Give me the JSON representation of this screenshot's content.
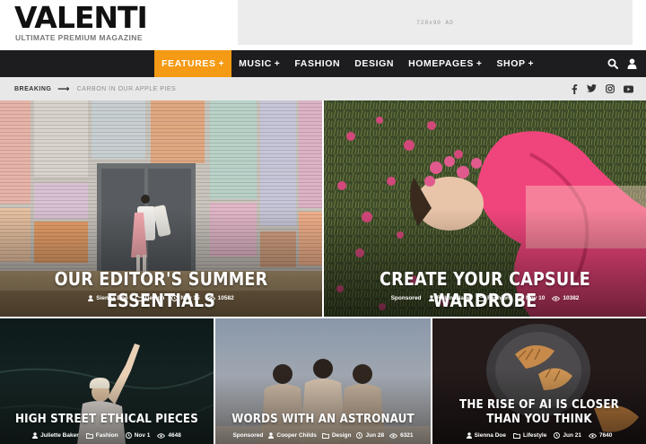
{
  "brand": {
    "name": "VALENTI",
    "tagline": "ULTIMATE PREMIUM MAGAZINE"
  },
  "ad": {
    "label": "728x90 AD"
  },
  "nav": {
    "items": [
      {
        "label": "FEATURES",
        "has_submenu": true,
        "active": true
      },
      {
        "label": "MUSIC",
        "has_submenu": true,
        "active": false
      },
      {
        "label": "FASHION",
        "has_submenu": false,
        "active": false
      },
      {
        "label": "DESIGN",
        "has_submenu": false,
        "active": false
      },
      {
        "label": "HOMEPAGES",
        "has_submenu": true,
        "active": false
      },
      {
        "label": "SHOP",
        "has_submenu": true,
        "active": false
      }
    ],
    "accent_color": "#f59a14",
    "tools": [
      "search-icon",
      "user-icon"
    ]
  },
  "breaking": {
    "label": "BREAKING",
    "headline": "CARBON IN OUR APPLE PIES"
  },
  "socials": [
    "facebook-icon",
    "twitter-icon",
    "instagram-icon",
    "youtube-icon"
  ],
  "featured": [
    {
      "title": "OUR EDITOR'S SUMMER ESSENTIALS",
      "sponsored": "",
      "author": "Sienna Doe",
      "category": "Design",
      "date": "Nov 15",
      "views": "10582"
    },
    {
      "title": "CREATE YOUR CAPSULE WARDROBE",
      "sponsored": "Sponsored",
      "author": "Robin Blake",
      "category": "Fashion",
      "date": "Nov 10",
      "views": "10382"
    },
    {
      "title": "HIGH STREET ETHICAL PIECES",
      "sponsored": "",
      "author": "Juliette Baker",
      "category": "Fashion",
      "date": "Nov 1",
      "views": "4648"
    },
    {
      "title": "WORDS WITH AN ASTRONAUT",
      "sponsored": "Sponsored",
      "author": "Cooper Childs",
      "category": "Design",
      "date": "Jun 28",
      "views": "6321"
    },
    {
      "title": "THE RISE OF AI IS CLOSER THAN YOU THINK",
      "sponsored": "",
      "author": "Sienna Doe",
      "category": "Lifestyle",
      "date": "Jun 21",
      "views": "7640"
    }
  ]
}
